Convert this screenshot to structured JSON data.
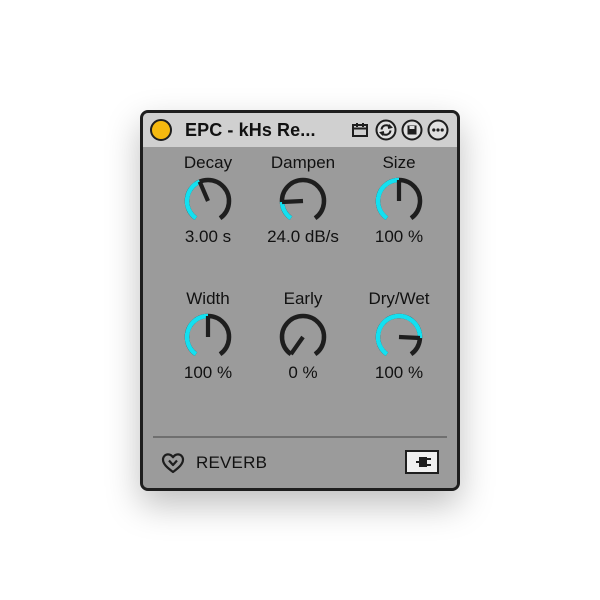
{
  "titlebar": {
    "title": "EPC - kHs Re...",
    "power_color": "#f5b90f",
    "icons": [
      "calendar-icon",
      "refresh-icon",
      "save-icon",
      "more-icon"
    ]
  },
  "knobs": [
    {
      "id": "decay",
      "label": "Decay",
      "value": "3.00 s",
      "fraction": 0.42
    },
    {
      "id": "dampen",
      "label": "Dampen",
      "value": "24.0 dB/s",
      "fraction": 0.18
    },
    {
      "id": "size",
      "label": "Size",
      "value": "100 %",
      "fraction": 0.5
    },
    {
      "id": "width",
      "label": "Width",
      "value": "100 %",
      "fraction": 0.5
    },
    {
      "id": "early",
      "label": "Early",
      "value": "0 %",
      "fraction": 0.0
    },
    {
      "id": "drywet",
      "label": "Dry/Wet",
      "value": "100 %",
      "fraction": 0.82
    }
  ],
  "footer": {
    "label": "REVERB",
    "logo_icon": "heart-logo-icon",
    "plug_icon": "plug-icon"
  },
  "colors": {
    "accent": "#14e0f0",
    "track": "#1e1e1e",
    "panel": "#9b9b9b",
    "titlebar": "#d0d0d0"
  }
}
